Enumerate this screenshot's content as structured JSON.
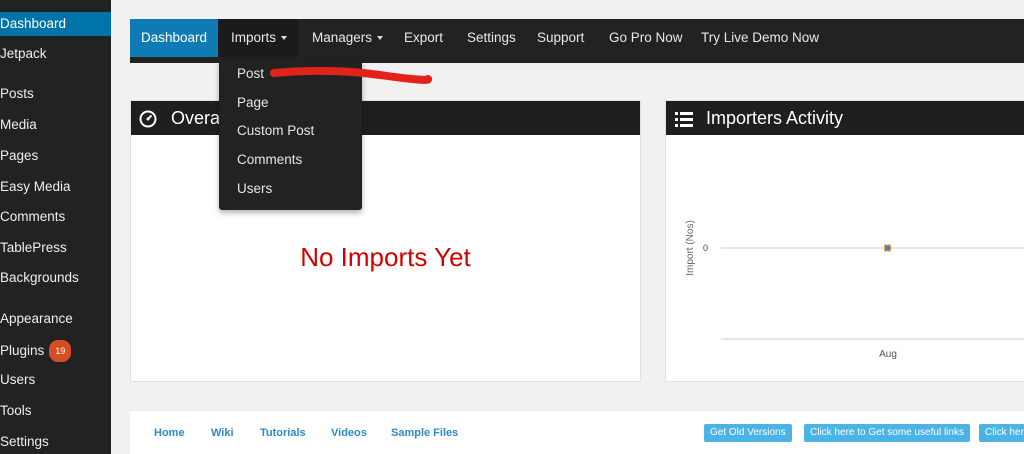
{
  "sidebar": {
    "items": [
      {
        "label": "Dashboard"
      },
      {
        "label": "Jetpack"
      },
      {
        "label": "Posts"
      },
      {
        "label": "Media"
      },
      {
        "label": "Pages"
      },
      {
        "label": "Easy Media"
      },
      {
        "label": "Comments"
      },
      {
        "label": "TablePress"
      },
      {
        "label": "Backgrounds"
      },
      {
        "label": "Appearance"
      },
      {
        "label": "Plugins",
        "badge": "19"
      },
      {
        "label": "Users"
      },
      {
        "label": "Tools"
      },
      {
        "label": "Settings"
      }
    ]
  },
  "nav": {
    "items": [
      {
        "label": "Dashboard"
      },
      {
        "label": "Imports"
      },
      {
        "label": "Managers"
      },
      {
        "label": "Export"
      },
      {
        "label": "Settings"
      },
      {
        "label": "Support"
      },
      {
        "label": "Go Pro Now"
      },
      {
        "label": "Try Live Demo Now"
      }
    ]
  },
  "imports_menu": {
    "items": [
      {
        "label": "Post"
      },
      {
        "label": "Page"
      },
      {
        "label": "Custom Post"
      },
      {
        "label": "Comments"
      },
      {
        "label": "Users"
      }
    ]
  },
  "overall_panel": {
    "title": "Overall Stats",
    "visible_title": "Overal",
    "empty_message": "No Imports Yet"
  },
  "activity_panel": {
    "title": "Importers Activity"
  },
  "chart_data": {
    "type": "line",
    "categories": [
      "Aug"
    ],
    "series": [
      {
        "values": [
          0
        ]
      }
    ],
    "ylabel": "Import (Nos)",
    "xlabel": "",
    "yticks": [
      "0"
    ]
  },
  "footer": {
    "links": [
      {
        "label": "Home"
      },
      {
        "label": "Wiki"
      },
      {
        "label": "Tutorials"
      },
      {
        "label": "Videos"
      },
      {
        "label": "Sample Files"
      }
    ],
    "buttons": [
      {
        "label": "Get Old Versions"
      },
      {
        "label": "Click here to Get some useful links"
      },
      {
        "label": "Click here"
      }
    ]
  },
  "colors": {
    "accent": "#0e7bb5",
    "wp_active": "#0073aa",
    "dark": "#222222",
    "error_red": "#d60000",
    "link": "#2f8bc8",
    "button": "#4cb3e6",
    "badge": "#d54e21"
  }
}
